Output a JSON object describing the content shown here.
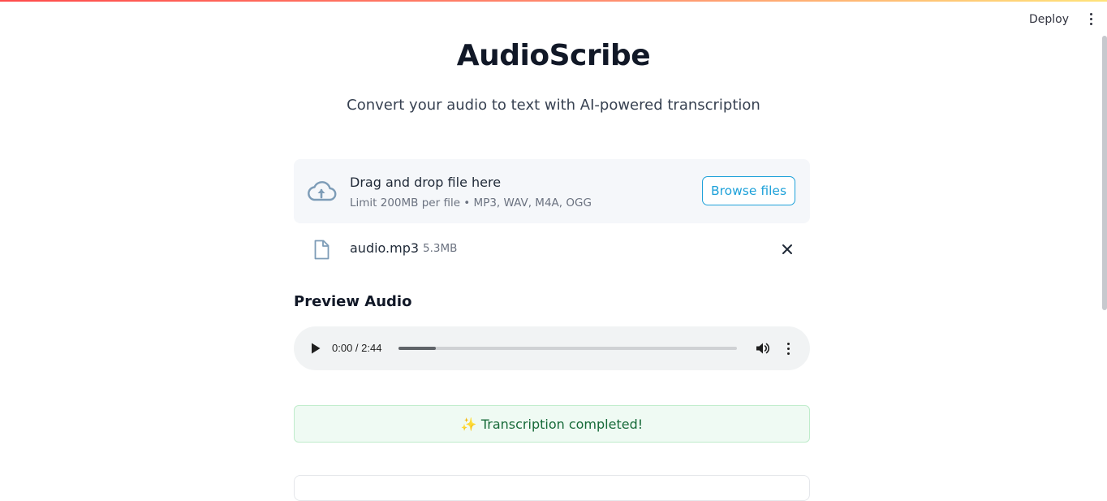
{
  "header": {
    "deploy_label": "Deploy"
  },
  "app": {
    "title": "AudioScribe",
    "subtitle": "Convert your audio to text with AI-powered transcription"
  },
  "uploader": {
    "drop_title": "Drag and drop file here",
    "limit_text": "Limit 200MB per file • MP3, WAV, M4A, OGG",
    "browse_label": "Browse files",
    "icon": "cloud-upload-icon"
  },
  "uploaded_file": {
    "name": "audio.mp3",
    "size": "5.3MB",
    "icon": "file-icon"
  },
  "preview": {
    "heading": "Preview Audio",
    "time_display": "0:00 / 2:44",
    "progress_fraction": 0.11
  },
  "status": {
    "message": "✨ Transcription completed!"
  },
  "colors": {
    "accent": "#1ea1d9",
    "success_bg": "#effaf3",
    "success_text": "#176a39",
    "title_text": "#111827"
  }
}
